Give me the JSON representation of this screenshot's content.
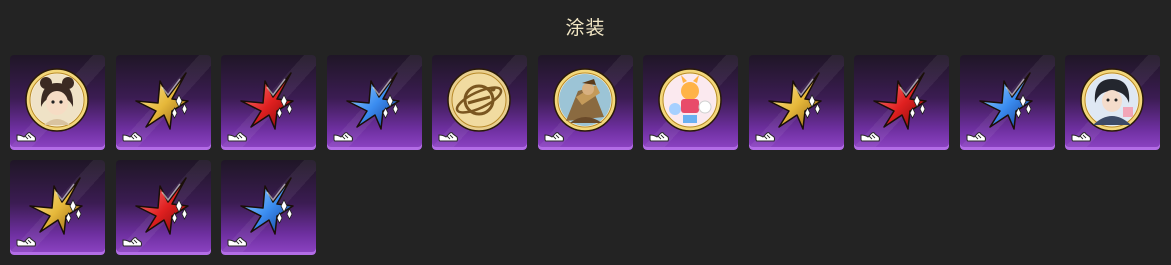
{
  "header": {
    "title": "涂装"
  },
  "palette": {
    "gold": [
      "#fff0b0",
      "#e6b83a",
      "#8a5a10"
    ],
    "red": [
      "#ff9090",
      "#e02020",
      "#7a0606"
    ],
    "blue": [
      "#b8e4ff",
      "#3a8cf0",
      "#14368a"
    ]
  },
  "items": [
    {
      "kind": "portrait",
      "subject": "girl-with-bear-ears",
      "icon": "portrait-girl-icon"
    },
    {
      "kind": "star",
      "color": "gold",
      "icon": "gold-star-icon"
    },
    {
      "kind": "star",
      "color": "red",
      "icon": "red-star-icon"
    },
    {
      "kind": "star",
      "color": "blue",
      "icon": "blue-star-icon"
    },
    {
      "kind": "emblem",
      "subject": "gold-planet-ring",
      "icon": "planet-emblem-icon"
    },
    {
      "kind": "portrait",
      "subject": "armored-warrior",
      "icon": "portrait-warrior-icon"
    },
    {
      "kind": "portrait",
      "subject": "chibi-characters",
      "icon": "portrait-chibi-icon"
    },
    {
      "kind": "star",
      "color": "gold",
      "icon": "gold-star-icon"
    },
    {
      "kind": "star",
      "color": "red",
      "icon": "red-star-icon"
    },
    {
      "kind": "star",
      "color": "blue",
      "icon": "blue-star-icon"
    },
    {
      "kind": "portrait",
      "subject": "dark-haired-boy",
      "icon": "portrait-boy-icon"
    },
    {
      "kind": "star",
      "color": "gold",
      "icon": "gold-star-icon"
    },
    {
      "kind": "star",
      "color": "red",
      "icon": "red-star-icon"
    },
    {
      "kind": "star",
      "color": "blue",
      "icon": "blue-star-icon"
    }
  ]
}
